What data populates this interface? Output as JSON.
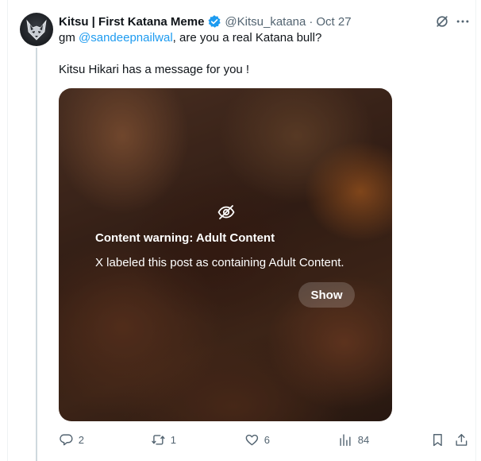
{
  "tweet": {
    "display_name": "Kitsu | First Katana Meme",
    "handle": "@Kitsu_katana",
    "separator": "·",
    "time": "Oct 27",
    "text_prefix": "gm ",
    "mention": "@sandeepnailwal",
    "text_suffix": ", are you a real Katana bull?",
    "text_line2": "Kitsu Hikari has a message for you !"
  },
  "media": {
    "warning_title": "Content warning: Adult Content",
    "warning_description": "X labeled this post as containing Adult Content.",
    "show_label": "Show"
  },
  "actions": {
    "replies": "2",
    "reposts": "1",
    "likes": "6",
    "views": "84"
  },
  "icons": {
    "verified": "verified-badge-icon",
    "grok": "grok-icon",
    "more": "more-icon",
    "eye_off": "eye-off-icon",
    "reply": "reply-icon",
    "repost": "repost-icon",
    "like": "heart-icon",
    "views": "views-chart-icon",
    "bookmark": "bookmark-icon",
    "share": "share-icon"
  },
  "colors": {
    "accent": "#1d9bf0",
    "text": "#0f1419",
    "secondary": "#536471",
    "thread_line": "#cfd9de"
  }
}
